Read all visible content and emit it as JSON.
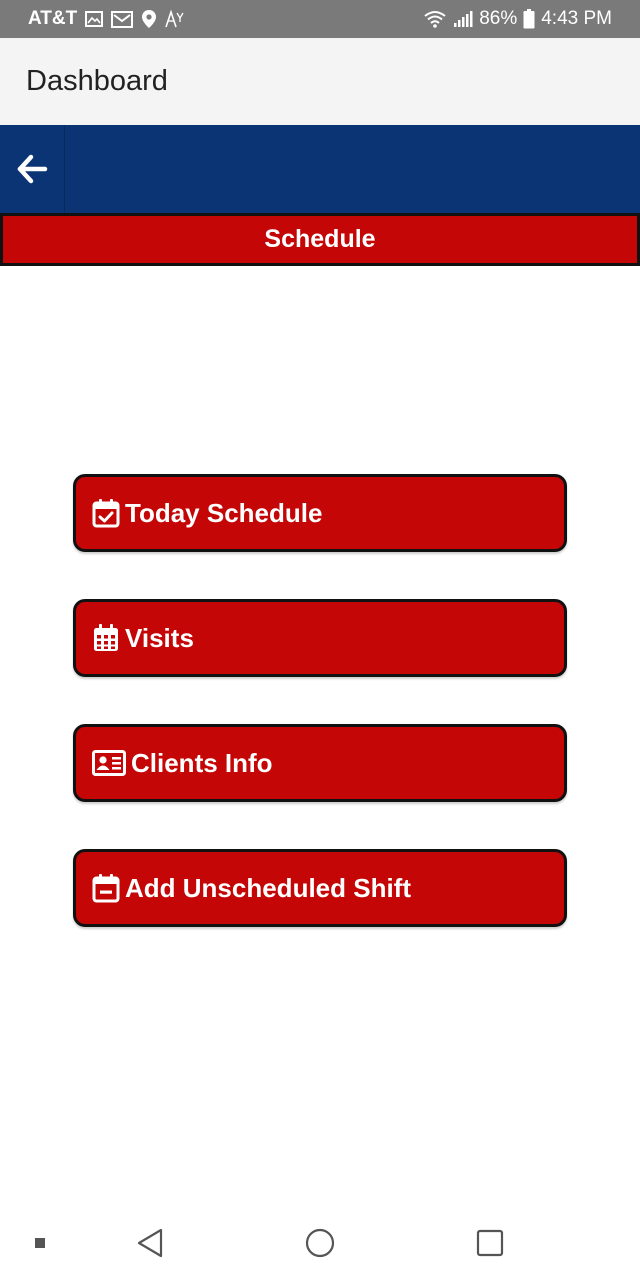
{
  "status_bar": {
    "carrier": "AT&T",
    "battery": "86%",
    "time": "4:43 PM",
    "icons_left": [
      "image-icon",
      "mail-icon",
      "location-icon",
      "text-accessibility-icon"
    ],
    "icons_right": [
      "wifi-icon",
      "signal-icon",
      "battery-icon"
    ]
  },
  "app_bar": {
    "title": "Dashboard"
  },
  "nav": {
    "back_icon": "arrow-left-icon"
  },
  "section": {
    "title": "Schedule"
  },
  "menu": [
    {
      "label": "Today Schedule",
      "icon": "calendar-check-icon"
    },
    {
      "label": "Visits",
      "icon": "calendar-grid-icon"
    },
    {
      "label": "Clients Info",
      "icon": "id-card-icon"
    },
    {
      "label": "Add Unscheduled Shift",
      "icon": "calendar-minus-icon"
    }
  ],
  "colors": {
    "status_bar": "#7a7a7a",
    "app_bar": "#f4f4f4",
    "nav_band": "#0a3473",
    "accent_red": "#c40606",
    "border": "#111111"
  }
}
